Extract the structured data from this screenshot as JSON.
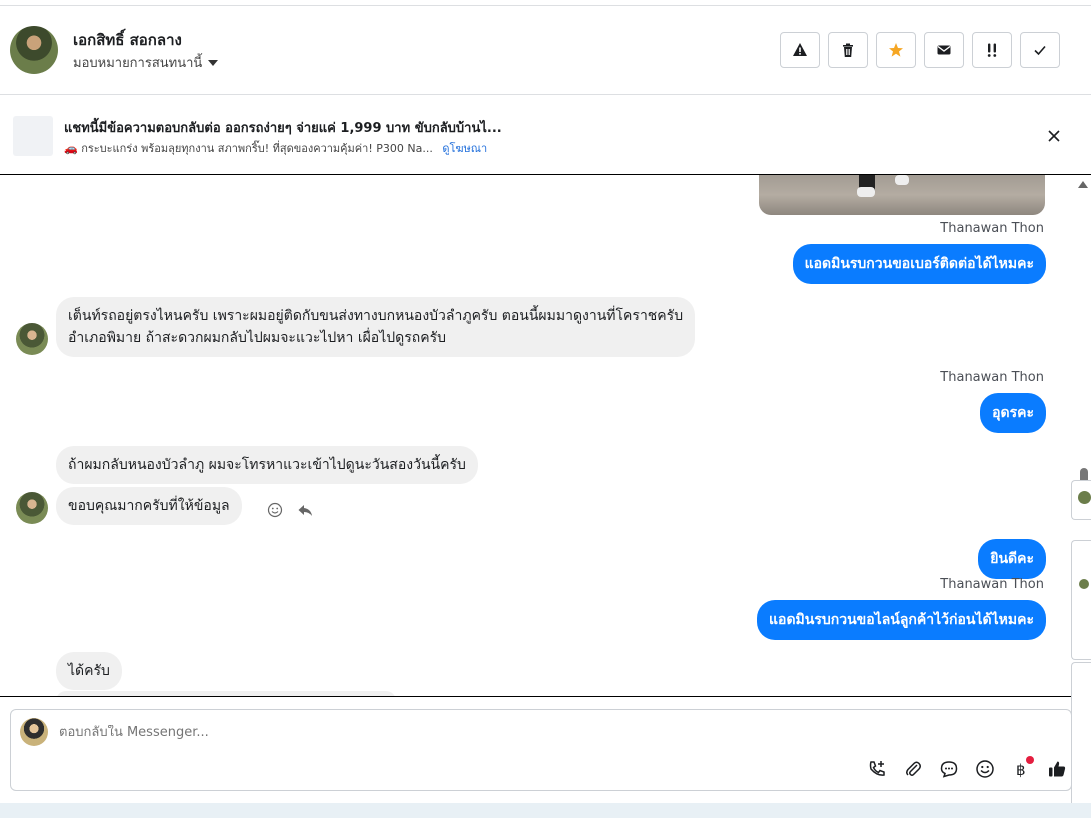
{
  "header": {
    "contact_name": "เอกสิทธิ์ สอกลาง",
    "assign_label": "มอบหมายการสนทนานี้",
    "actions": [
      {
        "icon": "warning-icon",
        "color": "#1c1e21"
      },
      {
        "icon": "trash-icon",
        "color": "#1c1e21"
      },
      {
        "icon": "star-icon",
        "color": "#f5a623"
      },
      {
        "icon": "envelope-icon",
        "color": "#1c1e21"
      },
      {
        "icon": "follow-up-icon",
        "color": "#1c1e21"
      },
      {
        "icon": "check-icon",
        "color": "#1c1e21"
      }
    ]
  },
  "ad": {
    "title": "แชทนี้มีข้อความตอบกลับต่อ ออกรถง่ายๆ จ่ายแค่ 1,999 บาท ขับกลับบ้านไ...",
    "subtitle": "🚗 กระบะแกร่ง พร้อมลุยทุกงาน สภาพกริ๊บ! ที่สุดของความคุ้มค่า! P300 Na...",
    "link": "ดูโฆษณา"
  },
  "messages": {
    "sender1": "Thanawan Thon",
    "out1": "แอดมินรบกวนขอเบอร์ติดต่อได้ไหมคะ",
    "in1_line1": "เต็นท์รถอยู่ตรงไหนครับ เพราะผมอยู่ติดกับขนส่งทางบกหนองบัวลำภูครับ ตอนนี้ผมมาดูงานที่โคราชครับ",
    "in1_line2": "อำเภอพิมาย ถ้าสะดวกผมกลับไปผมจะแวะไปหา เผื่อไปดูรถครับ",
    "sender2": "Thanawan Thon",
    "out2": "อุดรคะ",
    "in2": "ถ้าผมกลับหนองบัวลำภู ผมจะโทรหาแวะเข้าไปดูนะวันสองวันนี้ครับ",
    "in3": "ขอบคุณมากครับที่ให้ข้อมูล",
    "out3": "ยินดีคะ",
    "sender3": "Thanawan Thon",
    "out4": "แอดมินรบกวนขอไลน์ลูกค้าไว้ก่อนได้ไหมคะ",
    "in4": "ได้ครับ"
  },
  "composer": {
    "placeholder": "ตอบกลับใน Messenger...",
    "tools": [
      "call-add-icon",
      "attachment-icon",
      "saved-reply-icon",
      "emoji-icon",
      "baht-payment-icon",
      "thumbs-up-icon"
    ]
  },
  "colors": {
    "outgoing_bubble": "#0a7cff",
    "incoming_bubble": "#f0f0f0",
    "link": "#216fdb",
    "star": "#f5a623",
    "notification_dot": "#e41e3f"
  }
}
